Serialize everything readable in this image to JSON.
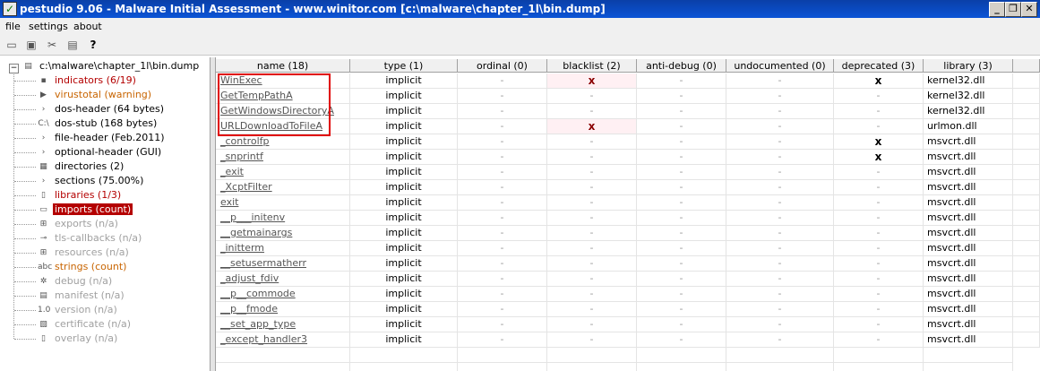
{
  "window": {
    "title": "pestudio 9.06 - Malware Initial Assessment - www.winitor.com [c:\\malware\\chapter_1l\\bin.dump]",
    "app_icon": "check-icon",
    "controls": [
      "_",
      "❐",
      "✕"
    ]
  },
  "menu": [
    "file",
    "settings",
    "about"
  ],
  "toolbar": {
    "icons": [
      "open-folder-icon",
      "save-icon",
      "cut-icon",
      "clipboard-icon",
      "help-icon"
    ],
    "help_glyph": "?"
  },
  "tree": {
    "root": "c:\\malware\\chapter_1l\\bin.dump",
    "expand_glyph": "−",
    "items": [
      {
        "label": "indicators (6/19)",
        "icon": "bar-chart-icon",
        "glyph": "▪",
        "color": "red"
      },
      {
        "label": "virustotal (warning)",
        "icon": "virustotal-icon",
        "glyph": "▶",
        "color": "orange"
      },
      {
        "label": "dos-header (64 bytes)",
        "icon": "arrow-right-icon",
        "glyph": "›",
        "color": "black"
      },
      {
        "label": "dos-stub (168 bytes)",
        "icon": "console-icon",
        "glyph": "C:\\",
        "color": "black"
      },
      {
        "label": "file-header (Feb.2011)",
        "icon": "arrow-right-icon",
        "glyph": "›",
        "color": "black"
      },
      {
        "label": "optional-header (GUI)",
        "icon": "arrow-right-icon",
        "glyph": "›",
        "color": "black"
      },
      {
        "label": "directories (2)",
        "icon": "directory-icon",
        "glyph": "▦",
        "color": "black"
      },
      {
        "label": "sections (75.00%)",
        "icon": "arrow-right-icon",
        "glyph": "›",
        "color": "black"
      },
      {
        "label": "libraries (1/3)",
        "icon": "library-icon",
        "glyph": "▯",
        "color": "red"
      },
      {
        "label": "imports (count)",
        "icon": "imports-icon",
        "glyph": "▭",
        "color": "red",
        "selected": true
      },
      {
        "label": "exports (n/a)",
        "icon": "exports-icon",
        "glyph": "⊞",
        "color": "gray"
      },
      {
        "label": "tls-callbacks (n/a)",
        "icon": "tls-icon",
        "glyph": "⊸",
        "color": "gray"
      },
      {
        "label": "resources (n/a)",
        "icon": "resources-icon",
        "glyph": "⊞",
        "color": "gray"
      },
      {
        "label": "strings (count)",
        "icon": "strings-icon",
        "glyph": "abc",
        "color": "orange"
      },
      {
        "label": "debug (n/a)",
        "icon": "bug-icon",
        "glyph": "✲",
        "color": "gray"
      },
      {
        "label": "manifest (n/a)",
        "icon": "manifest-icon",
        "glyph": "▤",
        "color": "gray"
      },
      {
        "label": "version (n/a)",
        "icon": "version-icon",
        "glyph": "1.0",
        "color": "gray"
      },
      {
        "label": "certificate (n/a)",
        "icon": "certificate-icon",
        "glyph": "▧",
        "color": "gray"
      },
      {
        "label": "overlay (n/a)",
        "icon": "overlay-icon",
        "glyph": "▯",
        "color": "gray"
      }
    ]
  },
  "table": {
    "columns": [
      "name (18)",
      "type (1)",
      "ordinal (0)",
      "blacklist (2)",
      "anti-debug (0)",
      "undocumented (0)",
      "deprecated (3)",
      "library (3)"
    ],
    "rows": [
      {
        "name": "WinExec",
        "type": "implicit",
        "ordinal": "-",
        "blacklist": "x",
        "anti_debug": "-",
        "undocumented": "-",
        "deprecated": "x",
        "library": "kernel32.dll"
      },
      {
        "name": "GetTempPathA",
        "type": "implicit",
        "ordinal": "-",
        "blacklist": "-",
        "anti_debug": "-",
        "undocumented": "-",
        "deprecated": "-",
        "library": "kernel32.dll"
      },
      {
        "name": "GetWindowsDirectoryA",
        "type": "implicit",
        "ordinal": "-",
        "blacklist": "-",
        "anti_debug": "-",
        "undocumented": "-",
        "deprecated": "-",
        "library": "kernel32.dll"
      },
      {
        "name": "URLDownloadToFileA",
        "type": "implicit",
        "ordinal": "-",
        "blacklist": "x",
        "anti_debug": "-",
        "undocumented": "-",
        "deprecated": "-",
        "library": "urlmon.dll"
      },
      {
        "name": "_controlfp",
        "type": "implicit",
        "ordinal": "-",
        "blacklist": "-",
        "anti_debug": "-",
        "undocumented": "-",
        "deprecated": "x",
        "library": "msvcrt.dll"
      },
      {
        "name": "_snprintf",
        "type": "implicit",
        "ordinal": "-",
        "blacklist": "-",
        "anti_debug": "-",
        "undocumented": "-",
        "deprecated": "x",
        "library": "msvcrt.dll"
      },
      {
        "name": "_exit",
        "type": "implicit",
        "ordinal": "-",
        "blacklist": "-",
        "anti_debug": "-",
        "undocumented": "-",
        "deprecated": "-",
        "library": "msvcrt.dll"
      },
      {
        "name": "_XcptFilter",
        "type": "implicit",
        "ordinal": "-",
        "blacklist": "-",
        "anti_debug": "-",
        "undocumented": "-",
        "deprecated": "-",
        "library": "msvcrt.dll"
      },
      {
        "name": "exit",
        "type": "implicit",
        "ordinal": "-",
        "blacklist": "-",
        "anti_debug": "-",
        "undocumented": "-",
        "deprecated": "-",
        "library": "msvcrt.dll"
      },
      {
        "name": "__p___initenv",
        "type": "implicit",
        "ordinal": "-",
        "blacklist": "-",
        "anti_debug": "-",
        "undocumented": "-",
        "deprecated": "-",
        "library": "msvcrt.dll"
      },
      {
        "name": "__getmainargs",
        "type": "implicit",
        "ordinal": "-",
        "blacklist": "-",
        "anti_debug": "-",
        "undocumented": "-",
        "deprecated": "-",
        "library": "msvcrt.dll"
      },
      {
        "name": "_initterm",
        "type": "implicit",
        "ordinal": "-",
        "blacklist": "-",
        "anti_debug": "-",
        "undocumented": "-",
        "deprecated": "-",
        "library": "msvcrt.dll"
      },
      {
        "name": "__setusermatherr",
        "type": "implicit",
        "ordinal": "-",
        "blacklist": "-",
        "anti_debug": "-",
        "undocumented": "-",
        "deprecated": "-",
        "library": "msvcrt.dll"
      },
      {
        "name": "_adjust_fdiv",
        "type": "implicit",
        "ordinal": "-",
        "blacklist": "-",
        "anti_debug": "-",
        "undocumented": "-",
        "deprecated": "-",
        "library": "msvcrt.dll"
      },
      {
        "name": "__p__commode",
        "type": "implicit",
        "ordinal": "-",
        "blacklist": "-",
        "anti_debug": "-",
        "undocumented": "-",
        "deprecated": "-",
        "library": "msvcrt.dll"
      },
      {
        "name": "__p__fmode",
        "type": "implicit",
        "ordinal": "-",
        "blacklist": "-",
        "anti_debug": "-",
        "undocumented": "-",
        "deprecated": "-",
        "library": "msvcrt.dll"
      },
      {
        "name": "__set_app_type",
        "type": "implicit",
        "ordinal": "-",
        "blacklist": "-",
        "anti_debug": "-",
        "undocumented": "-",
        "deprecated": "-",
        "library": "msvcrt.dll"
      },
      {
        "name": "_except_handler3",
        "type": "implicit",
        "ordinal": "-",
        "blacklist": "-",
        "anti_debug": "-",
        "undocumented": "-",
        "deprecated": "-",
        "library": "msvcrt.dll"
      }
    ],
    "highlight": {
      "color": "#e00000",
      "covers_rows": 4
    }
  },
  "colors": {
    "titlebar": "#0b54d6",
    "selected": "#b40000",
    "red": "#b40000",
    "orange": "#c86400",
    "gray": "#a0a0a0",
    "blacklist_bg": "#fff0f3"
  }
}
